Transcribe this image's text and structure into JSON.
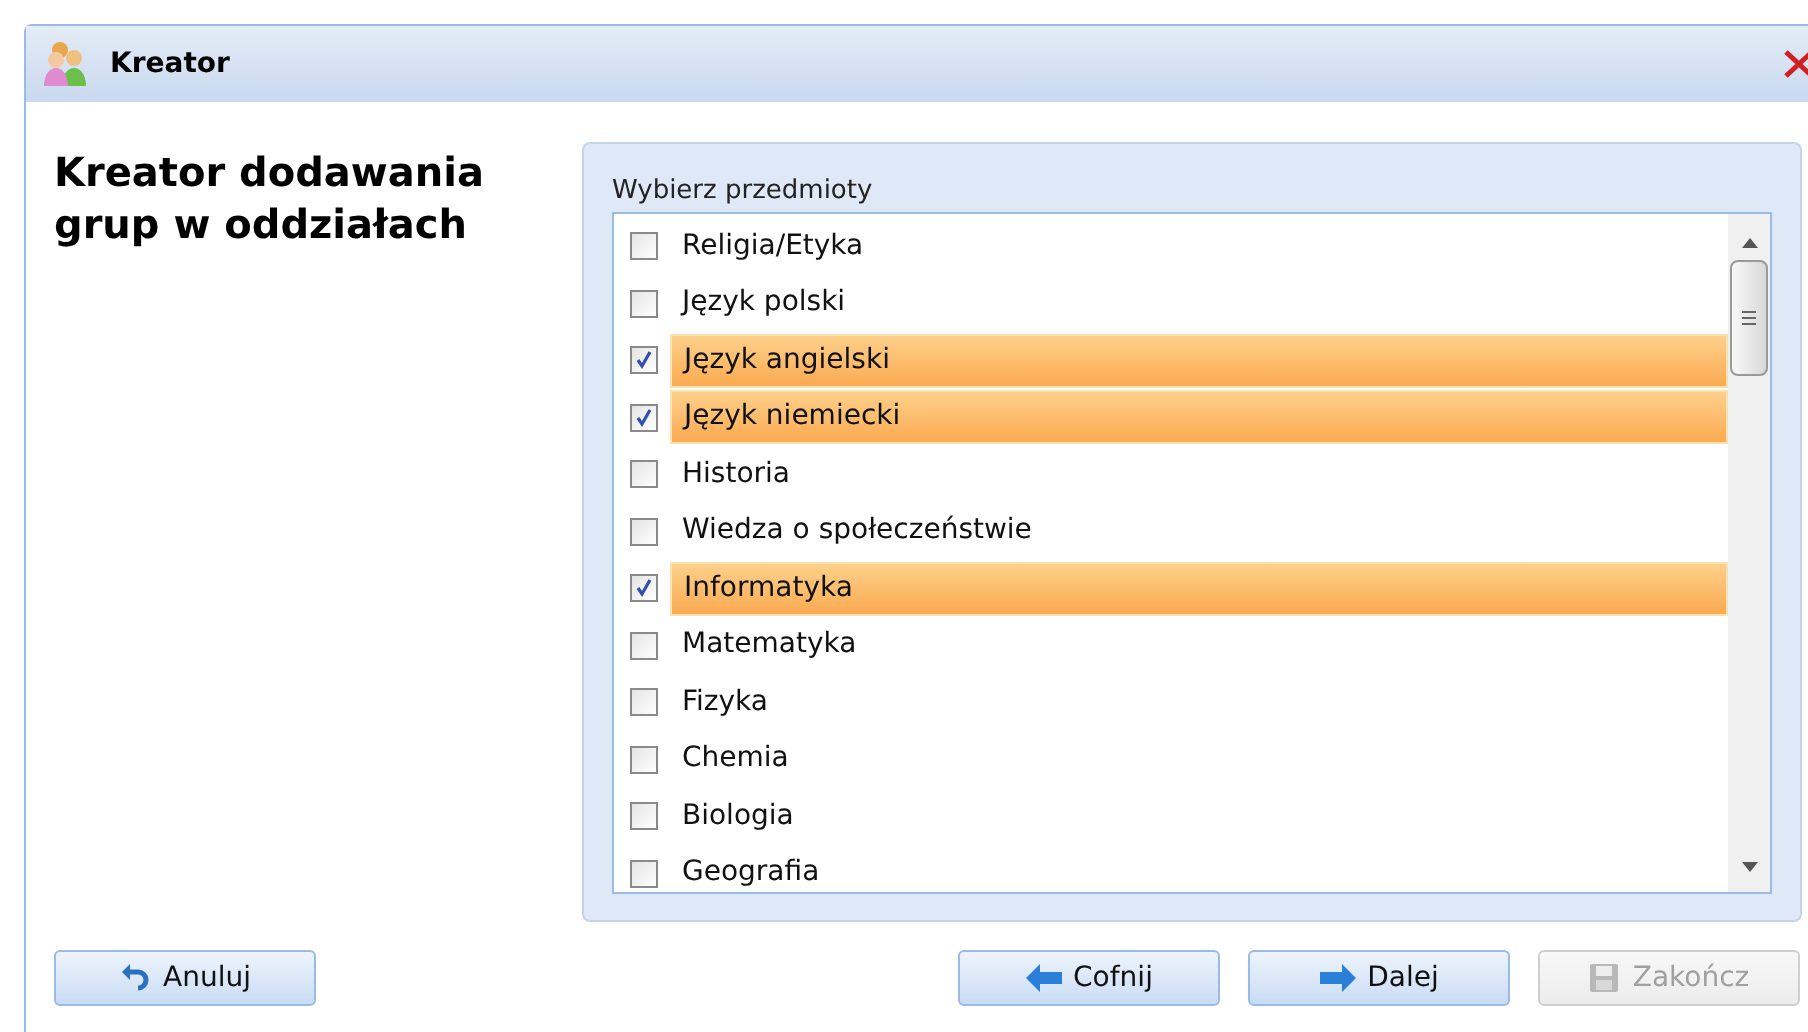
{
  "window": {
    "title": "Kreator"
  },
  "heading": "Kreator dodawania grup w oddziałach",
  "subjects": {
    "label": "Wybierz przedmioty",
    "items": [
      {
        "label": "Religia/Etyka",
        "checked": false
      },
      {
        "label": "Język polski",
        "checked": false
      },
      {
        "label": "Język angielski",
        "checked": true
      },
      {
        "label": "Język niemiecki",
        "checked": true
      },
      {
        "label": "Historia",
        "checked": false
      },
      {
        "label": "Wiedza o społeczeństwie",
        "checked": false
      },
      {
        "label": "Informatyka",
        "checked": true
      },
      {
        "label": "Matematyka",
        "checked": false
      },
      {
        "label": "Fizyka",
        "checked": false
      },
      {
        "label": "Chemia",
        "checked": false
      },
      {
        "label": "Biologia",
        "checked": false
      },
      {
        "label": "Geografia",
        "checked": false
      }
    ]
  },
  "buttons": [
    {
      "label": "Anuluj",
      "kind": "cancel",
      "disabled": false
    },
    {
      "label": "Cofnij",
      "kind": "back",
      "disabled": false
    },
    {
      "label": "Dalej",
      "kind": "next",
      "disabled": false
    },
    {
      "label": "Zakończ",
      "kind": "finish",
      "disabled": true
    }
  ]
}
